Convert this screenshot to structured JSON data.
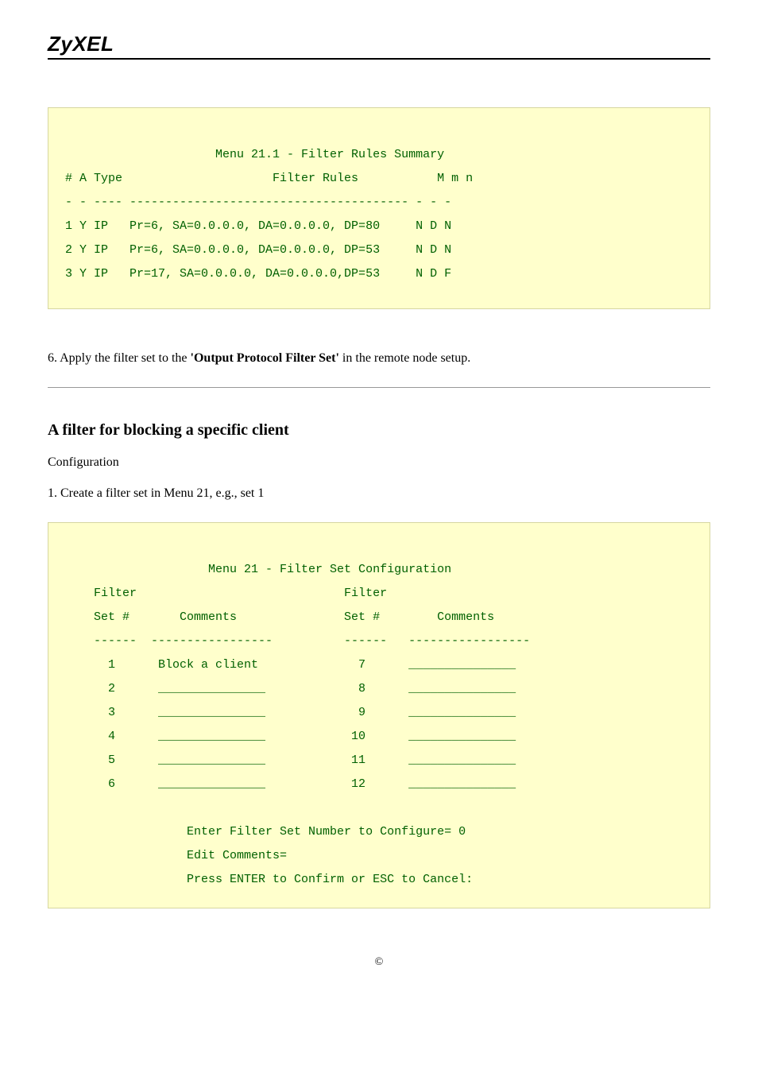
{
  "header": {
    "brand": "ZyXEL"
  },
  "terminal1": {
    "title": "                      Menu 21.1 - Filter Rules Summary",
    "hdr": " # A Type                     Filter Rules           M m n",
    "sep": " - - ---- --------------------------------------- - - -",
    "row1": " 1 Y IP   Pr=6, SA=0.0.0.0, DA=0.0.0.0, DP=80     N D N",
    "row2": " 2 Y IP   Pr=6, SA=0.0.0.0, DA=0.0.0.0, DP=53     N D N",
    "row3": " 3 Y IP   Pr=17, SA=0.0.0.0, DA=0.0.0.0,DP=53     N D F"
  },
  "step6": {
    "pre": "6. Apply the filter set to the ",
    "bold": "'Output Protocol Filter Set'",
    "post": " in the remote node setup."
  },
  "section": {
    "title": "A filter for blocking a specific client",
    "cfg": "Configuration",
    "step1": "1. Create a filter set in Menu 21, e.g., set 1"
  },
  "terminal2": {
    "title": "                     Menu 21 - Filter Set Configuration",
    "hdr1": "     Filter                             Filter",
    "hdr2": "     Set #       Comments               Set #        Comments",
    "sep": "     ------  -----------------          ------   -----------------",
    "row1": "       1      Block a client              7      _______________",
    "row2": "       2      _______________             8      _______________",
    "row3": "       3      _______________             9      _______________",
    "row4": "       4      _______________            10      _______________",
    "row5": "       5      _______________            11      _______________",
    "row6": "       6      _______________            12      _______________",
    "blank": "",
    "p1": "                  Enter Filter Set Number to Configure= 0",
    "p2": "                  Edit Comments=",
    "p3": "                  Press ENTER to Confirm or ESC to Cancel:"
  },
  "footer": {
    "copyright": "©"
  }
}
